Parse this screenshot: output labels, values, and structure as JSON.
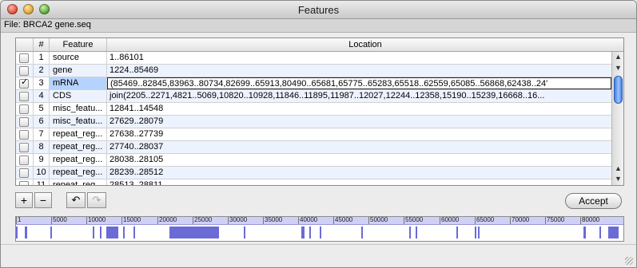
{
  "window": {
    "title": "Features"
  },
  "file_label": "File: BRCA2 gene.seq",
  "table": {
    "columns": {
      "check": "",
      "num": "#",
      "feature": "Feature",
      "location": "Location"
    },
    "rows": [
      {
        "checked": false,
        "num": "1",
        "feature": "source",
        "location": "1..86101"
      },
      {
        "checked": false,
        "num": "2",
        "feature": "gene",
        "location": "1224..85469"
      },
      {
        "checked": true,
        "num": "3",
        "feature": "mRNA",
        "location": "'24..56868,62438..62559,65085..65283,65518..65681,65775..65913,80490..80734,82699..82845,83963..85469)"
      },
      {
        "checked": false,
        "num": "4",
        "feature": "CDS",
        "location": "join(2205..2271,4821..5069,10820..10928,11846..11895,11987..12027,12244..12358,15190..15239,16668..16..."
      },
      {
        "checked": false,
        "num": "5",
        "feature": "misc_featu...",
        "location": "12841..14548"
      },
      {
        "checked": false,
        "num": "6",
        "feature": "misc_featu...",
        "location": "27629..28079"
      },
      {
        "checked": false,
        "num": "7",
        "feature": "repeat_reg...",
        "location": "27638..27739"
      },
      {
        "checked": false,
        "num": "8",
        "feature": "repeat_reg...",
        "location": "27740..28037"
      },
      {
        "checked": false,
        "num": "9",
        "feature": "repeat_reg...",
        "location": "28038..28105"
      },
      {
        "checked": false,
        "num": "10",
        "feature": "repeat_reg...",
        "location": "28239..28512"
      },
      {
        "checked": false,
        "num": "11",
        "feature": "repeat_reg...",
        "location": "28513..28811"
      }
    ],
    "selected_row": 3,
    "scroll": {
      "up_icon": "triangle-up-icon",
      "down_icon": "triangle-down-icon"
    }
  },
  "toolbar": {
    "add_label": "+",
    "remove_label": "−",
    "undo_icon": "undo-arrow-icon",
    "redo_icon": "redo-arrow-icon",
    "undo_glyph": "↶",
    "redo_glyph": "↷",
    "accept_label": "Accept"
  },
  "sequence_map": {
    "length": 86101,
    "ruler_labels": [
      "1",
      "5000",
      "10000",
      "15000",
      "20000",
      "25000",
      "30000",
      "35000",
      "40000",
      "45000",
      "50000",
      "55000",
      "60000",
      "65000",
      "70000",
      "75000",
      "80000"
    ],
    "ruler_positions": [
      1,
      5000,
      10000,
      15000,
      20000,
      25000,
      30000,
      35000,
      40000,
      45000,
      50000,
      55000,
      60000,
      65000,
      70000,
      75000,
      80000
    ],
    "feature_segments": [
      [
        1,
        100
      ],
      [
        1224,
        1600
      ],
      [
        4821,
        5069
      ],
      [
        10820,
        10928
      ],
      [
        11846,
        11895
      ],
      [
        12841,
        14548
      ],
      [
        15190,
        15239
      ],
      [
        16668,
        16800
      ],
      [
        21800,
        27739
      ],
      [
        27740,
        28811
      ],
      [
        32300,
        32500
      ],
      [
        40400,
        40900
      ],
      [
        41600,
        41800
      ],
      [
        43100,
        43300
      ],
      [
        48900,
        49100
      ],
      [
        55700,
        55900
      ],
      [
        56700,
        56868
      ],
      [
        62438,
        62559
      ],
      [
        65085,
        65283
      ],
      [
        65518,
        65681
      ],
      [
        80490,
        80734
      ],
      [
        82699,
        82845
      ],
      [
        83963,
        85469
      ]
    ],
    "colors": {
      "segment": "#6b6bd6",
      "ruler": "#cfd0f5"
    }
  },
  "colors": {
    "selection": "#b5d3ff",
    "alt_row": "#edf3fe",
    "scroll_thumb": "#3f7fe3"
  }
}
